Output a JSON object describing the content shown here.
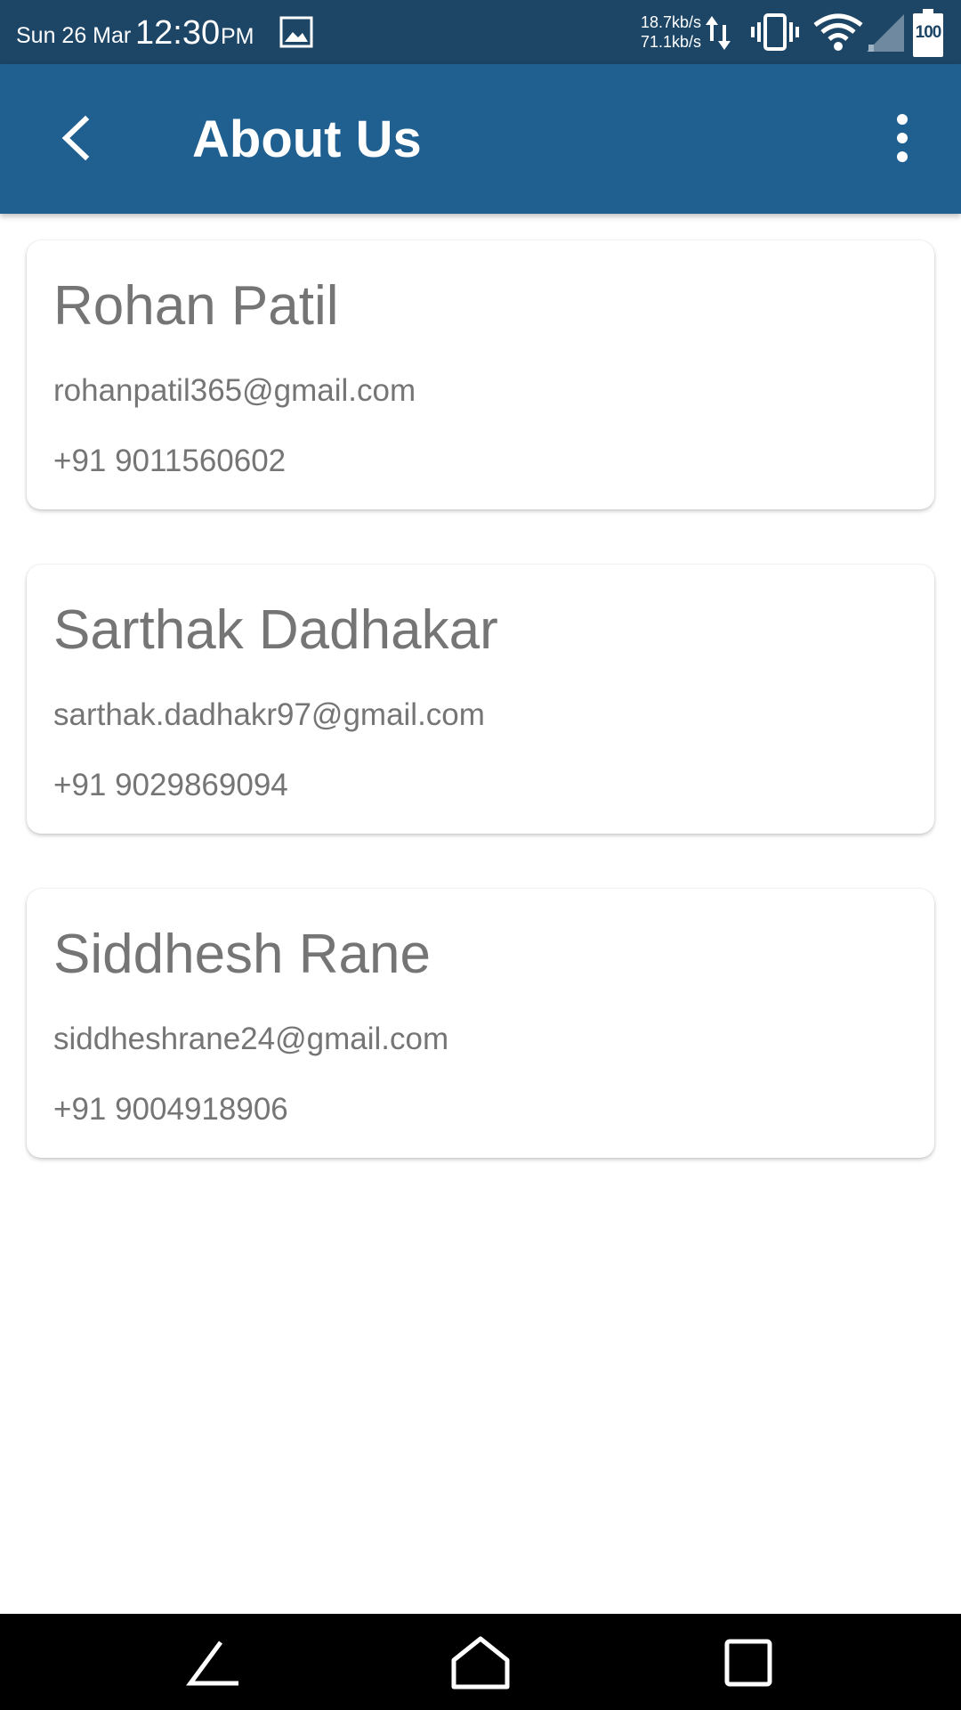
{
  "status_bar": {
    "date": "Sun 26 Mar",
    "time": "12:30",
    "ampm": "PM",
    "upload_speed": "18.7kb/s",
    "download_speed": "71.1kb/s",
    "battery_level": "100",
    "icons": [
      "gallery-icon",
      "data-arrows-icon",
      "vibrate-icon",
      "wifi-icon",
      "signal-icon",
      "battery-icon"
    ]
  },
  "app_bar": {
    "title": "About Us",
    "back_icon": "chevron-left-icon",
    "menu_icon": "more-vertical-icon",
    "color": "#1f6091"
  },
  "contacts": [
    {
      "name": "Rohan Patil",
      "email": "rohanpatil365@gmail.com",
      "phone": "+91 9011560602"
    },
    {
      "name": "Sarthak Dadhakar",
      "email": "sarthak.dadhakr97@gmail.com",
      "phone": "+91 9029869094"
    },
    {
      "name": "Siddhesh Rane",
      "email": "siddheshrane24@gmail.com",
      "phone": "+91 9004918906"
    }
  ],
  "nav_bar": {
    "icons": [
      "nav-back-icon",
      "nav-home-icon",
      "nav-recents-icon"
    ]
  }
}
